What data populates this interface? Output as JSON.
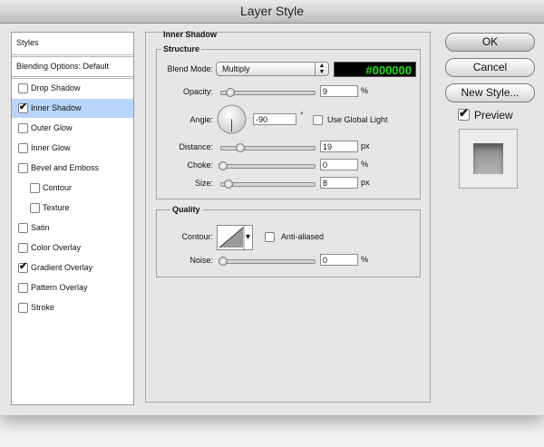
{
  "window": {
    "title": "Layer Style"
  },
  "styles_list": {
    "header": "Styles",
    "blending": "Blending Options: Default",
    "items": [
      {
        "label": "Drop Shadow",
        "checked": false,
        "selected": false,
        "indent": false
      },
      {
        "label": "Inner Shadow",
        "checked": true,
        "selected": true,
        "indent": false
      },
      {
        "label": "Outer Glow",
        "checked": false,
        "selected": false,
        "indent": false
      },
      {
        "label": "Inner Glow",
        "checked": false,
        "selected": false,
        "indent": false
      },
      {
        "label": "Bevel and Emboss",
        "checked": false,
        "selected": false,
        "indent": false
      },
      {
        "label": "Contour",
        "checked": false,
        "selected": false,
        "indent": true
      },
      {
        "label": "Texture",
        "checked": false,
        "selected": false,
        "indent": true
      },
      {
        "label": "Satin",
        "checked": false,
        "selected": false,
        "indent": false
      },
      {
        "label": "Color Overlay",
        "checked": false,
        "selected": false,
        "indent": false
      },
      {
        "label": "Gradient Overlay",
        "checked": true,
        "selected": false,
        "indent": false
      },
      {
        "label": "Pattern Overlay",
        "checked": false,
        "selected": false,
        "indent": false
      },
      {
        "label": "Stroke",
        "checked": false,
        "selected": false,
        "indent": false
      }
    ]
  },
  "inner_shadow": {
    "title": "Inner Shadow",
    "structure": {
      "title": "Structure",
      "blend_mode_label": "Blend Mode:",
      "blend_mode": "Multiply",
      "color_hex": "#000000",
      "opacity_label": "Opacity:",
      "opacity": "9",
      "opacity_unit": "%",
      "angle_label": "Angle:",
      "angle": "-90",
      "angle_unit": "°",
      "use_global_light_label": "Use Global Light",
      "use_global_light": false,
      "distance_label": "Distance:",
      "distance": "19",
      "distance_unit": "px",
      "choke_label": "Choke:",
      "choke": "0",
      "choke_unit": "%",
      "size_label": "Size:",
      "size": "8",
      "size_unit": "px"
    },
    "quality": {
      "title": "Quality",
      "contour_label": "Contour:",
      "anti_aliased_label": "Anti-aliased",
      "anti_aliased": false,
      "noise_label": "Noise:",
      "noise": "0",
      "noise_unit": "%"
    }
  },
  "buttons": {
    "ok": "OK",
    "cancel": "Cancel",
    "new_style": "New Style..."
  },
  "preview": {
    "label": "Preview",
    "checked": true
  },
  "colors": {
    "selection": "#b9d5fb",
    "swatch_text": "#22e01d",
    "swatch_bg": "#000000"
  }
}
